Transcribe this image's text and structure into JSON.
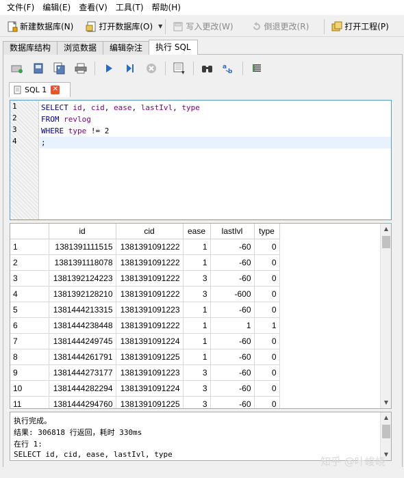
{
  "menu": [
    "文件(F)",
    "编辑(E)",
    "查看(V)",
    "工具(T)",
    "帮助(H)"
  ],
  "toolbar": {
    "new_db": "新建数据库(N)",
    "open_db": "打开数据库(O)",
    "write_changes": "写入更改(W)",
    "revert_changes": "倒退更改(R)",
    "open_project": "打开工程(P)"
  },
  "tabs": [
    "数据库结构",
    "浏览数据",
    "编辑杂注",
    "执行 SQL"
  ],
  "sql_tab": {
    "label": "SQL 1"
  },
  "editor": {
    "line_numbers": [
      "1",
      "2",
      "3",
      "4"
    ],
    "lines": [
      [
        {
          "t": "SELECT ",
          "c": "kw"
        },
        {
          "t": "id",
          "c": "id"
        },
        {
          "t": ", ",
          "c": "op"
        },
        {
          "t": "cid",
          "c": "id"
        },
        {
          "t": ", ",
          "c": "op"
        },
        {
          "t": "ease",
          "c": "id"
        },
        {
          "t": ", ",
          "c": "op"
        },
        {
          "t": "lastIvl",
          "c": "id"
        },
        {
          "t": ", ",
          "c": "op"
        },
        {
          "t": "type",
          "c": "id"
        }
      ],
      [
        {
          "t": "FROM ",
          "c": "kw"
        },
        {
          "t": "revlog",
          "c": "id"
        }
      ],
      [
        {
          "t": "WHERE ",
          "c": "kw"
        },
        {
          "t": "type",
          "c": "id"
        },
        {
          "t": " != ",
          "c": "op"
        },
        {
          "t": "2",
          "c": "num"
        }
      ],
      [
        {
          "t": ";",
          "c": "op"
        }
      ]
    ]
  },
  "results": {
    "columns": [
      "",
      "id",
      "cid",
      "ease",
      "lastIvl",
      "type"
    ],
    "rows": [
      [
        "1",
        "1381391111515",
        "1381391091222",
        "1",
        "-60",
        "0"
      ],
      [
        "2",
        "1381391118078",
        "1381391091222",
        "1",
        "-60",
        "0"
      ],
      [
        "3",
        "1381392124223",
        "1381391091222",
        "3",
        "-60",
        "0"
      ],
      [
        "4",
        "1381392128210",
        "1381391091222",
        "3",
        "-600",
        "0"
      ],
      [
        "5",
        "1381444213315",
        "1381391091223",
        "1",
        "-60",
        "0"
      ],
      [
        "6",
        "1381444238448",
        "1381391091222",
        "1",
        "1",
        "1"
      ],
      [
        "7",
        "1381444249745",
        "1381391091224",
        "1",
        "-60",
        "0"
      ],
      [
        "8",
        "1381444261791",
        "1381391091225",
        "1",
        "-60",
        "0"
      ],
      [
        "9",
        "1381444273177",
        "1381391091223",
        "3",
        "-60",
        "0"
      ],
      [
        "10",
        "1381444282294",
        "1381391091224",
        "3",
        "-60",
        "0"
      ],
      [
        "11",
        "1381444294760",
        "1381391091225",
        "3",
        "-60",
        "0"
      ]
    ]
  },
  "log": {
    "lines": [
      "执行完成。",
      "结果: 306818 行返回，耗时 330ms",
      "在行 1:",
      "SELECT id, cid, ease, lastIvl, type"
    ]
  },
  "watermark": "知乎 @叶峻峣"
}
